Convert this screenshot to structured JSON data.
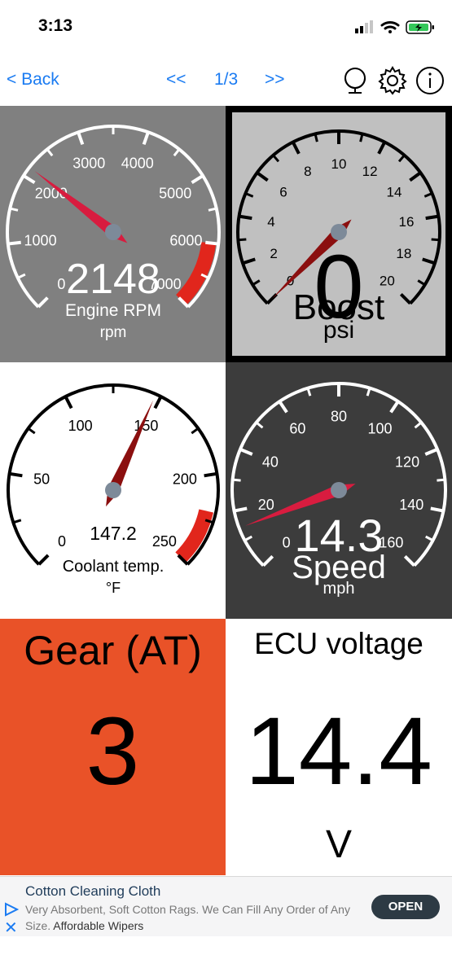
{
  "status": {
    "time": "3:13"
  },
  "nav": {
    "back": "< Back",
    "prev": "<<",
    "page": "1/3",
    "next": ">>",
    "icons": [
      "globe-icon",
      "gear-icon",
      "info-icon"
    ]
  },
  "gauges": [
    {
      "id": "rpm",
      "title": "Engine RPM",
      "unit": "rpm",
      "value_text": "2148",
      "value": 2148,
      "ticks": [
        "0",
        "1000",
        "2000",
        "3000",
        "4000",
        "5000",
        "6000",
        "7000"
      ],
      "min": 0,
      "max": 7000,
      "redline_from": 6000,
      "background": "#808080",
      "ink": "#ffffff"
    },
    {
      "id": "boost",
      "title": "Boost",
      "unit": "psi",
      "value_text": "0",
      "value": 0,
      "ticks": [
        "0",
        "2",
        "4",
        "6",
        "8",
        "10",
        "12",
        "14",
        "16",
        "18",
        "20"
      ],
      "min": 0,
      "max": 20,
      "background": "#c0c0c0",
      "ink": "#000000",
      "border": "#000000"
    },
    {
      "id": "coolant",
      "title": "Coolant temp.",
      "unit": "°F",
      "value_text": "147.2",
      "value": 147.2,
      "ticks": [
        "0",
        "50",
        "100",
        "150",
        "200",
        "250"
      ],
      "min": 0,
      "max": 250,
      "redline_from": 220,
      "background": "#ffffff",
      "ink": "#000000"
    },
    {
      "id": "speed",
      "title": "Speed",
      "unit": "mph",
      "value_text": "14.3",
      "value": 14.3,
      "ticks": [
        "0",
        "20",
        "40",
        "60",
        "80",
        "100",
        "120",
        "140",
        "160"
      ],
      "min": 0,
      "max": 160,
      "background": "#3c3c3c",
      "ink": "#ffffff"
    }
  ],
  "panels": {
    "gear": {
      "title": "Gear (AT)",
      "value": "3",
      "background": "#e95228"
    },
    "ecu": {
      "title": "ECU voltage",
      "value": "14.4",
      "unit": "V",
      "background": "#ffffff"
    }
  },
  "ad": {
    "title": "Cotton Cleaning Cloth",
    "text": "Very Absorbent, Soft Cotton Rags. We Can Fill Any Order of Any Size.",
    "link": "Affordable Wipers",
    "cta": "OPEN"
  },
  "colors": {
    "accent": "#1a7bf2",
    "needle": "#d81c3f",
    "redline": "#e1261c",
    "needle_dark": "#8b0f0f"
  }
}
